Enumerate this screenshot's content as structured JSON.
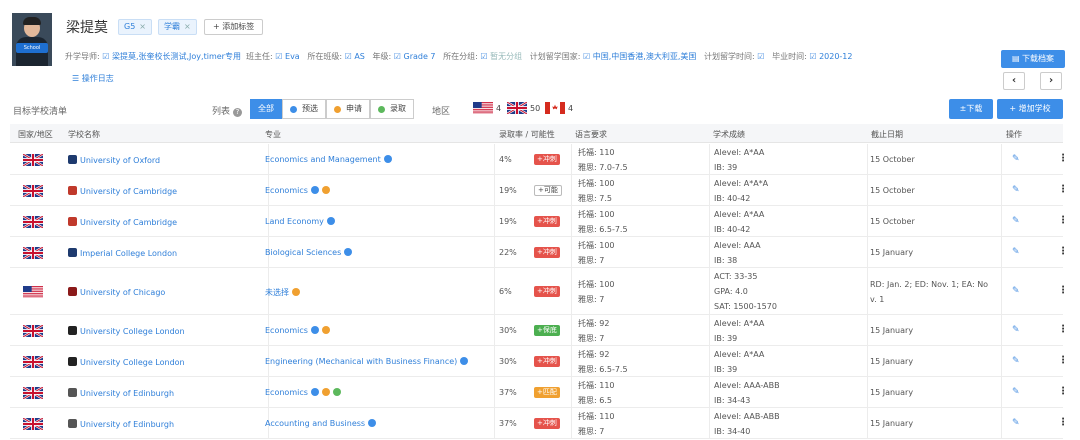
{
  "student": {
    "name": "梁提莫",
    "tags": [
      "G5",
      "学霸"
    ],
    "add_tag_label": "+ 添加标签",
    "photo_badge": "School"
  },
  "info": [
    {
      "label": "升学导师:",
      "value": "梁提莫,张奎校长测试,Joy,timer专用"
    },
    {
      "label": "班主任:",
      "value": "Eva"
    },
    {
      "label": "所在班级:",
      "value": "AS"
    },
    {
      "label": "年级:",
      "value": "Grade 7"
    },
    {
      "label": "所在分组:",
      "value": "暂无分组"
    },
    {
      "label": "计划留学国家:",
      "value": "中国,中国香港,澳大利亚,美国"
    },
    {
      "label": "计划留学时间:",
      "value": ""
    },
    {
      "label": "毕业时间:",
      "value": "2020-12"
    }
  ],
  "log_link": "操作日志",
  "download_profile": "下载档案",
  "pager": {
    "prev": "‹",
    "next": "›"
  },
  "toolbar": {
    "title": "目标学校清单",
    "list_label": "列表",
    "filters": [
      {
        "label": "全部",
        "active": true,
        "dot": ""
      },
      {
        "label": "预选",
        "active": false,
        "dot": "#3d8ee8"
      },
      {
        "label": "申请",
        "active": false,
        "dot": "#f0a030"
      },
      {
        "label": "录取",
        "active": false,
        "dot": "#5cb85c"
      }
    ],
    "region_label": "地区",
    "region_counts": [
      {
        "flag": "us",
        "count": "4"
      },
      {
        "flag": "uk",
        "count": "50"
      },
      {
        "flag": "ca",
        "count": "4"
      }
    ],
    "download_label": "±下载",
    "add_school_label": "+ 增加学校"
  },
  "columns": [
    "国家/地区",
    "学校名称",
    "专业",
    "录取率 / 可能性",
    "语言要求",
    "学术成绩",
    "截止日期",
    "操作"
  ],
  "rows": [
    {
      "flag": "uk",
      "school": "University of Oxford",
      "crest": "#1e3a6e",
      "major": "Economics and Management",
      "dots": [
        "#3d8ee8"
      ],
      "rate": "4%",
      "chance": "+冲刺",
      "chance_color": "#e5534b",
      "lang": [
        "托福: 110",
        "雅思: 7.0-7.5"
      ],
      "acad": [
        "Alevel: A*AA",
        "IB: 39"
      ],
      "deadline": [
        "15 October"
      ]
    },
    {
      "flag": "uk",
      "school": "University of Cambridge",
      "crest": "#c0392b",
      "major": "Economics",
      "dots": [
        "#3d8ee8",
        "#f0a030"
      ],
      "rate": "19%",
      "chance": "+可能",
      "chance_color": "outline",
      "lang": [
        "托福: 100",
        "雅思: 7.5"
      ],
      "acad": [
        "Alevel: A*A*A",
        "IB: 40-42"
      ],
      "deadline": [
        "15 October"
      ]
    },
    {
      "flag": "uk",
      "school": "University of Cambridge",
      "crest": "#c0392b",
      "major": "Land Economy",
      "dots": [
        "#3d8ee8"
      ],
      "rate": "19%",
      "chance": "+冲刺",
      "chance_color": "#e5534b",
      "lang": [
        "托福: 100",
        "雅思: 6.5-7.5"
      ],
      "acad": [
        "Alevel: A*AA",
        "IB: 40-42"
      ],
      "deadline": [
        "15 October"
      ]
    },
    {
      "flag": "uk",
      "school": "Imperial College London",
      "crest": "#1e3a6e",
      "major": "Biological Sciences",
      "dots": [
        "#3d8ee8"
      ],
      "rate": "22%",
      "chance": "+冲刺",
      "chance_color": "#e5534b",
      "lang": [
        "托福: 100",
        "雅思: 7"
      ],
      "acad": [
        "Alevel: AAA",
        "IB: 38"
      ],
      "deadline": [
        "15 January"
      ]
    },
    {
      "flag": "us",
      "school": "University of Chicago",
      "crest": "#8b1a1a",
      "major": "未选择",
      "dots": [
        "#f0a030"
      ],
      "rate": "6%",
      "chance": "+冲刺",
      "chance_color": "#e5534b",
      "lang": [
        "托福: 100",
        "雅思: 7"
      ],
      "acad": [
        "ACT:  33-35",
        "GPA:  4.0",
        "SAT:  1500-1570"
      ],
      "deadline": [
        "RD: Jan. 2;  ED: Nov. 1;  EA: No",
        "v. 1"
      ]
    },
    {
      "flag": "uk",
      "school": "University College London",
      "crest": "#222222",
      "major": "Economics",
      "dots": [
        "#3d8ee8",
        "#f0a030"
      ],
      "rate": "30%",
      "chance": "+保底",
      "chance_color": "#4caf50",
      "lang": [
        "托福: 92",
        "雅思: 7"
      ],
      "acad": [
        "Alevel: A*AA",
        "IB: 39"
      ],
      "deadline": [
        "15 January"
      ]
    },
    {
      "flag": "uk",
      "school": "University College London",
      "crest": "#222222",
      "major": "Engineering (Mechanical with Business Finance)",
      "dots": [
        "#3d8ee8"
      ],
      "rate": "30%",
      "chance": "+冲刺",
      "chance_color": "#e5534b",
      "lang": [
        "托福: 92",
        "雅思: 6.5-7.5"
      ],
      "acad": [
        "Alevel: A*AA",
        "IB: 39"
      ],
      "deadline": [
        "15 January"
      ]
    },
    {
      "flag": "uk",
      "school": "University of Edinburgh",
      "crest": "#555555",
      "major": "Economics",
      "dots": [
        "#3d8ee8",
        "#f0a030",
        "#5cb85c"
      ],
      "rate": "37%",
      "chance": "+匹配",
      "chance_color": "#f0a030",
      "lang": [
        "托福: 110",
        "雅思: 6.5"
      ],
      "acad": [
        "Alevel: AAA-ABB",
        "IB: 34-43"
      ],
      "deadline": [
        "15 January"
      ]
    },
    {
      "flag": "uk",
      "school": "University of Edinburgh",
      "crest": "#555555",
      "major": "Accounting and Business",
      "dots": [
        "#3d8ee8"
      ],
      "rate": "37%",
      "chance": "+冲刺",
      "chance_color": "#e5534b",
      "lang": [
        "托福: 110",
        "雅思: 7"
      ],
      "acad": [
        "Alevel: AAB-ABB",
        "IB: 34-40"
      ],
      "deadline": [
        "15 January"
      ]
    }
  ],
  "icons": {
    "edit": "edit-icon",
    "more": "more-vertical-icon",
    "download": "download-icon"
  },
  "colors": {
    "accent": "#3d8ee8",
    "link": "#2f7fd9"
  }
}
